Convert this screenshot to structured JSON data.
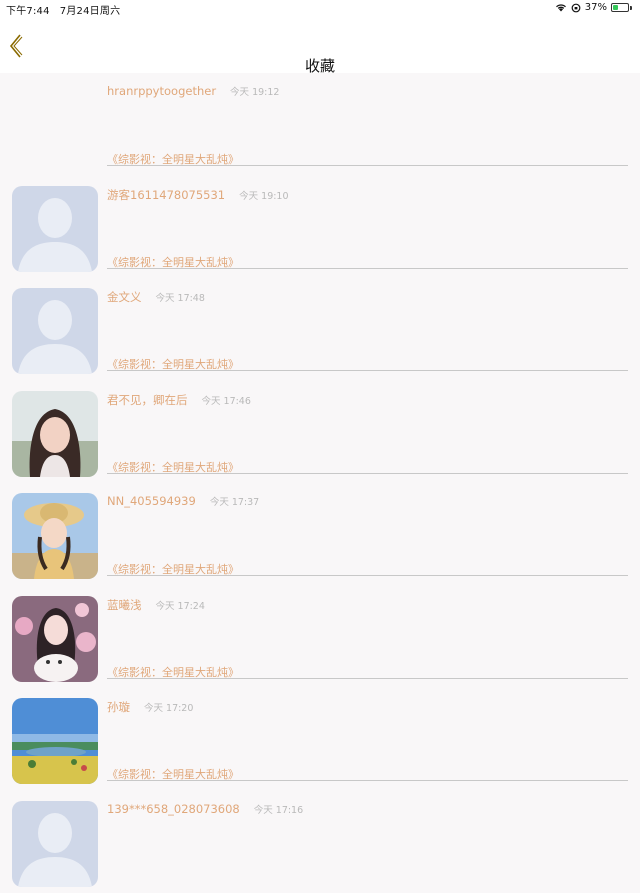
{
  "status_bar": {
    "time": "下午7:44",
    "date": "7月24日周六",
    "battery": "37%",
    "battery_level": 0.37
  },
  "nav": {
    "title": "收藏",
    "accent_color": "#e0a77a"
  },
  "items": [
    {
      "name": "hranrppytoogether",
      "time": "今天 19:12",
      "link": "《综影视：全明星大乱炖》",
      "avatar": "none"
    },
    {
      "name": "游客1611478075531",
      "time": "今天 19:10",
      "link": "《综影视：全明星大乱炖》",
      "avatar": "default"
    },
    {
      "name": "金文义",
      "time": "今天 17:48",
      "link": "《综影视：全明星大乱炖》",
      "avatar": "default"
    },
    {
      "name": "君不见，卿在后",
      "time": "今天 17:46",
      "link": "《综影视：全明星大乱炖》",
      "avatar": "photo-girl-snow"
    },
    {
      "name": "NN_405594939",
      "time": "今天 17:37",
      "link": "《综影视：全明星大乱炖》",
      "avatar": "photo-girl-hat"
    },
    {
      "name": "蓝曦浅",
      "time": "今天 17:24",
      "link": "《综影视：全明星大乱炖》",
      "avatar": "photo-girl-flowers"
    },
    {
      "name": "孙璇",
      "time": "今天 17:20",
      "link": "《综影视：全明星大乱炖》",
      "avatar": "photo-landscape"
    },
    {
      "name": "139***658_028073608",
      "time": "今天 17:16",
      "link": "",
      "avatar": "default"
    }
  ]
}
